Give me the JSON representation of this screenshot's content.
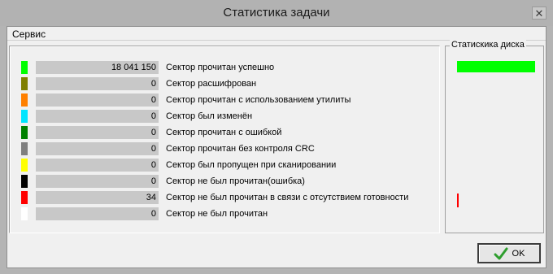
{
  "window": {
    "title": "Статистика задачи",
    "close_glyph": "✕"
  },
  "menu": {
    "items": [
      "Сервис"
    ]
  },
  "stats": {
    "rows": [
      {
        "color": "#00ff00",
        "count": "18 041 150",
        "label": "Сектор прочитан успешно"
      },
      {
        "color": "#808000",
        "count": "0",
        "label": "Сектор расшифрован"
      },
      {
        "color": "#ff8000",
        "count": "0",
        "label": "Сектор прочитан с использованием утилиты"
      },
      {
        "color": "#00e5ff",
        "count": "0",
        "label": "Сектор был изменён"
      },
      {
        "color": "#008000",
        "count": "0",
        "label": "Сектор прочитан с ошибкой"
      },
      {
        "color": "#808080",
        "count": "0",
        "label": "Сектор прочитан без контроля CRC"
      },
      {
        "color": "#ffff00",
        "count": "0",
        "label": "Сектор был пропущен при сканировании"
      },
      {
        "color": "#000000",
        "count": "0",
        "label": "Сектор не был прочитан(ошибка)"
      },
      {
        "color": "#ff0000",
        "count": "34",
        "label": "Сектор не был прочитан в связи с отсутствием готовности"
      },
      {
        "color": "#ffffff",
        "count": "0",
        "label": "Сектор не был прочитан"
      }
    ]
  },
  "disk_stats": {
    "legend": "Статискика диска",
    "bar_color": "#00ff00",
    "marker_color": "#ff0000"
  },
  "buttons": {
    "ok_label": "OK",
    "ok_icon": "checkmark-icon",
    "ok_icon_color": "#2e9e2e"
  }
}
